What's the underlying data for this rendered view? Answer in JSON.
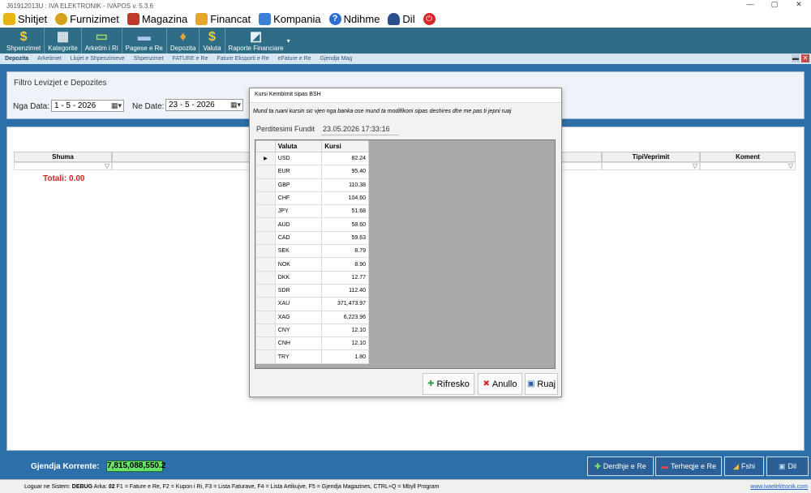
{
  "window": {
    "title": "J61912013U : IVA ELEKTRONIK - IVAPOS v. 5.3.6"
  },
  "menu": [
    {
      "label": "Shitjet",
      "icon": "dollar-coin-icon",
      "color": "#e7b416"
    },
    {
      "label": "Furnizimet",
      "icon": "coins-icon",
      "color": "#d6a11a"
    },
    {
      "label": "Magazina",
      "icon": "warehouse-icon",
      "color": "#c0392b"
    },
    {
      "label": "Financat",
      "icon": "finance-icon",
      "color": "#e6a52d"
    },
    {
      "label": "Kompania",
      "icon": "company-icon",
      "color": "#3b7fd6"
    },
    {
      "label": "Ndihme",
      "icon": "help-icon",
      "color": "#2b6fd1"
    },
    {
      "label": "Dil",
      "icon": "user-icon",
      "color": "#2a4f8e"
    }
  ],
  "toolbar": [
    {
      "label": "Shpenzimet",
      "icon": "dollar-icon",
      "glyph": "$"
    },
    {
      "label": "Kategorite",
      "icon": "calculator-icon",
      "glyph": "▦"
    },
    {
      "label": "Arketim i Ri",
      "icon": "cash-icon",
      "glyph": "▭"
    },
    {
      "label": "Pagese e Re",
      "icon": "card-icon",
      "glyph": "▬"
    },
    {
      "label": "Depozita",
      "icon": "money-bag-icon",
      "glyph": "♦"
    },
    {
      "label": "Valuta",
      "icon": "currency-icon",
      "glyph": "$"
    },
    {
      "label": "Raporte Financiare",
      "icon": "chart-icon",
      "glyph": "◩"
    }
  ],
  "tabs": [
    "Depozita",
    "Arketimet",
    "Llojet e Shpenzimeve",
    "Shpenzimet",
    "FATURE e Re",
    "Fature Eksporti e Re",
    "eFature e Re",
    "Gjendja Mag"
  ],
  "filter": {
    "title": "Filtro Levizjet e Depozites",
    "from_label": "Nga Data:",
    "from_value": "1 -  5 - 2026",
    "to_label": "Ne Date:",
    "to_value": "23 -  5 - 2026"
  },
  "grid": {
    "columns": [
      "Shuma",
      "TipiVeprimit",
      "Koment"
    ],
    "total": "Totali: 0.00"
  },
  "dialog": {
    "title": "Kursi Kembimit sipas BSH",
    "note": "Mund ta ruani kursin sic vjen nga banka ose mund ta modifikoni sipas deshires dhe me pas ti jepni ruaj",
    "updated_label": "Perditesimi Fundit",
    "updated_value": "23.05.2026 17:33:16",
    "col_currency": "Valuta",
    "col_rate": "Kursi",
    "rows": [
      {
        "currency": "USD",
        "rate": "82.24"
      },
      {
        "currency": "EUR",
        "rate": "95.40"
      },
      {
        "currency": "GBP",
        "rate": "110.38"
      },
      {
        "currency": "CHF",
        "rate": "104.60"
      },
      {
        "currency": "JPY",
        "rate": "51.68"
      },
      {
        "currency": "AUD",
        "rate": "58.60"
      },
      {
        "currency": "CAD",
        "rate": "59.63"
      },
      {
        "currency": "SEK",
        "rate": "8.79"
      },
      {
        "currency": "NOK",
        "rate": "8.90"
      },
      {
        "currency": "DKK",
        "rate": "12.77"
      },
      {
        "currency": "SDR",
        "rate": "112.40"
      },
      {
        "currency": "XAU",
        "rate": "371,473.97"
      },
      {
        "currency": "XAG",
        "rate": "6,223.96"
      },
      {
        "currency": "CNY",
        "rate": "12.10"
      },
      {
        "currency": "CNH",
        "rate": "12.10"
      },
      {
        "currency": "TRY",
        "rate": "1.80"
      }
    ],
    "buttons": {
      "refresh": "Rifresko",
      "cancel": "Anullo",
      "save": "Ruaj"
    }
  },
  "status": {
    "balance_label": "Gjendja Korrente:",
    "balance_value": "7,815,088,550.2",
    "deposit": "Derdhje e Re",
    "withdraw": "Terheqje e Re",
    "delete": "Fshi",
    "exit": "Dil"
  },
  "footer": {
    "logged_label": "Loguar ne Sistem:",
    "user": "DEBUG",
    "arka_label": "Arka:",
    "arka": "02",
    "shortcuts": "F1 = Fature e Re, F2 = Kupon i Ri, F3 = Lista Faturave, F4 = Lista Artikujve, F5 = Gjendja Magazines, CTRL+Q = Mbyll Program",
    "link": "www.ivaelektronik.com"
  }
}
